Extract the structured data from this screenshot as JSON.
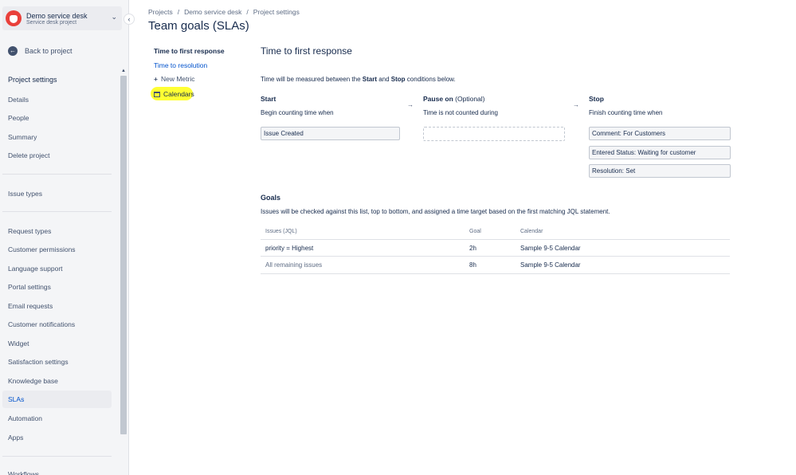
{
  "sidebar": {
    "project": {
      "name": "Demo service desk",
      "type": "Service desk project"
    },
    "back_label": "Back to project",
    "section_title": "Project settings",
    "items_group1": [
      {
        "label": "Details"
      },
      {
        "label": "People"
      },
      {
        "label": "Summary"
      },
      {
        "label": "Delete project"
      }
    ],
    "items_group2": [
      {
        "label": "Issue types"
      }
    ],
    "items_group3": [
      {
        "label": "Request types"
      },
      {
        "label": "Customer permissions"
      },
      {
        "label": "Language support"
      },
      {
        "label": "Portal settings"
      },
      {
        "label": "Email requests"
      },
      {
        "label": "Customer notifications"
      },
      {
        "label": "Widget"
      },
      {
        "label": "Satisfaction settings"
      },
      {
        "label": "Knowledge base"
      },
      {
        "label": "SLAs",
        "selected": true
      },
      {
        "label": "Automation"
      },
      {
        "label": "Apps"
      }
    ],
    "items_group4": [
      {
        "label": "Workflows"
      }
    ]
  },
  "breadcrumb": [
    "Projects",
    "Demo service desk",
    "Project settings"
  ],
  "page_title": "Team goals (SLAs)",
  "metrics": {
    "active": "Time to first response",
    "other": "Time to resolution",
    "new_metric": "New Metric",
    "calendars": "Calendars"
  },
  "sla": {
    "title": "Time to first response",
    "desc_pre": "Time will be measured between the ",
    "desc_start": "Start",
    "desc_and": " and ",
    "desc_stop": "Stop",
    "desc_post": " conditions below.",
    "start": {
      "title": "Start",
      "subtitle": "Begin counting time when",
      "conditions": [
        "Issue Created"
      ]
    },
    "pause": {
      "title": "Pause on",
      "optional": "(Optional)",
      "subtitle": "Time is not counted during"
    },
    "stop": {
      "title": "Stop",
      "subtitle": "Finish counting time when",
      "conditions": [
        "Comment: For Customers",
        "Entered Status: Waiting for customer",
        "Resolution: Set"
      ]
    }
  },
  "goals": {
    "title": "Goals",
    "desc": "Issues will be checked against this list, top to bottom, and assigned a time target based on the first matching JQL statement.",
    "headers": {
      "issues": "Issues (JQL)",
      "goal": "Goal",
      "calendar": "Calendar"
    },
    "rows": [
      {
        "jql": "priority = Highest",
        "goal": "2h",
        "calendar": "Sample 9-5 Calendar"
      },
      {
        "jql": "All remaining issues",
        "goal": "8h",
        "calendar": "Sample 9-5 Calendar"
      }
    ]
  }
}
